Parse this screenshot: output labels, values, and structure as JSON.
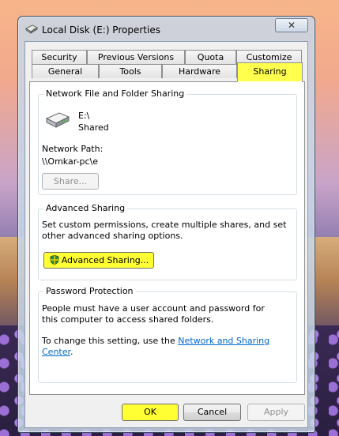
{
  "window": {
    "title": "Local Disk (E:) Properties",
    "close_glyph": "✕"
  },
  "tabs_row1": [
    "Security",
    "Previous Versions",
    "Quota",
    "Customize"
  ],
  "tabs_row2": [
    "General",
    "Tools",
    "Hardware",
    "Sharing"
  ],
  "network_sharing": {
    "legend": "Network File and Folder Sharing",
    "drive_name": "E:\\",
    "drive_status": "Shared",
    "path_label": "Network Path:",
    "path_value": "\\\\Omkar-pc\\e",
    "share_button": "Share..."
  },
  "advanced_sharing": {
    "legend": "Advanced Sharing",
    "description": "Set custom permissions, create multiple shares, and set other advanced sharing options.",
    "button": "Advanced Sharing..."
  },
  "password_protection": {
    "legend": "Password Protection",
    "description": "People must have a user account and password for this computer to access shared folders.",
    "change_prefix": "To change this setting, use the",
    "link": "Network and Sharing Center",
    "change_suffix": "."
  },
  "buttons": {
    "ok": "OK",
    "cancel": "Cancel",
    "apply": "Apply"
  },
  "colors": {
    "highlight": "#ffff33",
    "link": "#0066cc"
  }
}
